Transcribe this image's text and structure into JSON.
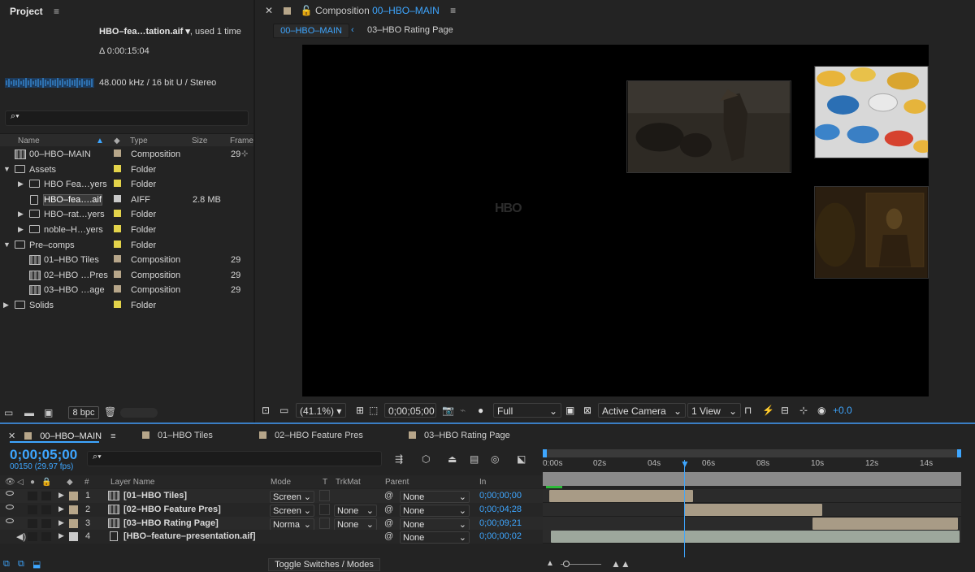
{
  "project": {
    "title": "Project",
    "menu": "≡",
    "file_name": "HBO–fea…tation.aif ▾",
    "used": ", used 1 time",
    "duration": "Δ 0:00:15:04",
    "audio_info": "48.000 kHz / 16 bit U / Stereo",
    "search_placeholder": "⌕▾",
    "columns": {
      "name": "Name",
      "type": "Type",
      "size": "Size",
      "frame": "Frame"
    },
    "items": [
      {
        "name": "00–HBO–MAIN",
        "type": "Composition",
        "size": "",
        "frame": "29",
        "color": "#b7a68a",
        "kind": "comp",
        "indent": 0
      },
      {
        "name": "Assets",
        "type": "Folder",
        "size": "",
        "frame": "",
        "color": "#e3d34a",
        "kind": "folder-open",
        "indent": 0
      },
      {
        "name": "HBO Fea…yers",
        "type": "Folder",
        "size": "",
        "frame": "",
        "color": "#e3d34a",
        "kind": "folder",
        "indent": 1
      },
      {
        "name": "HBO–fea….aif",
        "type": "AIFF",
        "size": "2.8 MB",
        "frame": "",
        "color": "#c9c9c9",
        "kind": "file",
        "indent": 1
      },
      {
        "name": "HBO–rat…yers",
        "type": "Folder",
        "size": "",
        "frame": "",
        "color": "#e3d34a",
        "kind": "folder",
        "indent": 1
      },
      {
        "name": "noble–H…yers",
        "type": "Folder",
        "size": "",
        "frame": "",
        "color": "#e3d34a",
        "kind": "folder",
        "indent": 1
      },
      {
        "name": "Pre–comps",
        "type": "Folder",
        "size": "",
        "frame": "",
        "color": "#e3d34a",
        "kind": "folder-open",
        "indent": 0
      },
      {
        "name": "01–HBO Tiles",
        "type": "Composition",
        "size": "",
        "frame": "29",
        "color": "#b7a68a",
        "kind": "comp",
        "indent": 1
      },
      {
        "name": "02–HBO …Pres",
        "type": "Composition",
        "size": "",
        "frame": "29",
        "color": "#b7a68a",
        "kind": "comp",
        "indent": 1
      },
      {
        "name": "03–HBO …age",
        "type": "Composition",
        "size": "",
        "frame": "29",
        "color": "#b7a68a",
        "kind": "comp",
        "indent": 1
      },
      {
        "name": "Solids",
        "type": "Folder",
        "size": "",
        "frame": "",
        "color": "#e3d34a",
        "kind": "folder",
        "indent": 0
      }
    ],
    "bpc": "8 bpc"
  },
  "comp": {
    "title_prefix": "Composition",
    "title_name": "00–HBO–MAIN",
    "menu": "≡",
    "tab_active": "00–HBO–MAIN",
    "tab_next": "03–HBO Rating Page",
    "canvas_logo": "HBO",
    "zoom": "(41.1%)",
    "timecode": "0;00;05;00",
    "resolution": "Full",
    "camera": "Active Camera",
    "views": "1 View",
    "exposure": "+0.0"
  },
  "timeline": {
    "tabs": [
      "00–HBO–MAIN",
      "01–HBO Tiles",
      "02–HBO Feature Pres",
      "03–HBO Rating Page"
    ],
    "tab_menu": "≡",
    "timecode": "0;00;05;00",
    "frames": "00150 (29.97 fps)",
    "headers": {
      "num": "#",
      "layer": "Layer Name",
      "mode": "Mode",
      "t": "T",
      "trkmat": "TrkMat",
      "parent": "Parent",
      "in": "In"
    },
    "ruler": [
      "0:00s",
      "02s",
      "04s",
      "06s",
      "08s",
      "10s",
      "12s",
      "14s"
    ],
    "layers": [
      {
        "num": "1",
        "name": "[01–HBO Tiles]",
        "mode": "Screen",
        "trkmat": "",
        "parent": "None",
        "in": "0;00;00;00",
        "kind": "comp",
        "start": 0,
        "end": 5.3,
        "color": "#b7a68a"
      },
      {
        "num": "2",
        "name": "[02–HBO Feature Pres]",
        "mode": "Screen",
        "trkmat": "None",
        "parent": "None",
        "in": "0;00;04;28",
        "kind": "comp",
        "start": 4.97,
        "end": 10.07,
        "color": "#b7a68a"
      },
      {
        "num": "3",
        "name": "[03–HBO Rating Page]",
        "mode": "Norma",
        "trkmat": "None",
        "parent": "None",
        "in": "0;00;09;21",
        "kind": "comp",
        "start": 9.7,
        "end": 15.07,
        "color": "#b7a68a"
      },
      {
        "num": "4",
        "name": "[HBO–feature–presentation.aif]",
        "mode": "",
        "trkmat": "",
        "parent": "None",
        "in": "0;00;00;02",
        "kind": "audio",
        "start": 0.07,
        "end": 15.13,
        "color": "#c9c9c9"
      }
    ],
    "duration_seconds": 15.13,
    "current_seconds": 5.0,
    "toggle_label": "Toggle Switches / Modes"
  }
}
